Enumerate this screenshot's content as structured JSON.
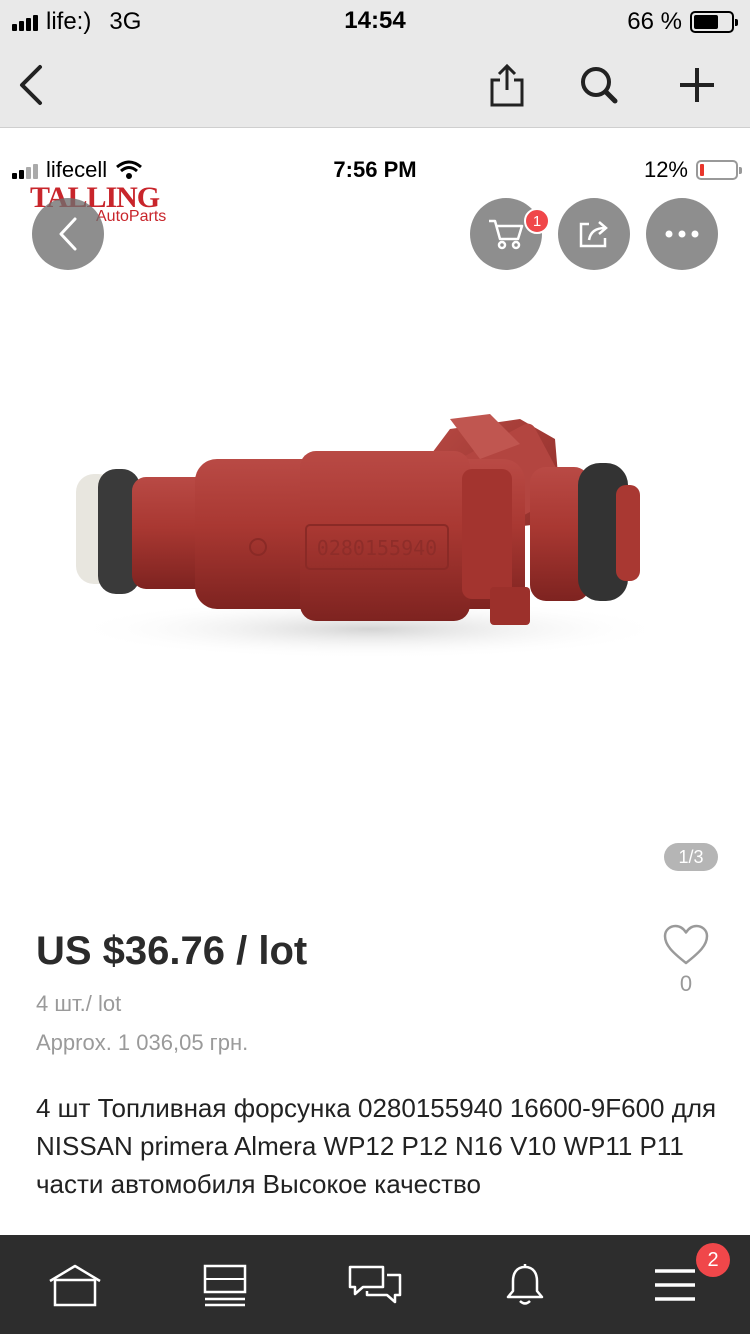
{
  "outer_status": {
    "carrier": "life:)",
    "network": "3G",
    "time": "14:54",
    "battery": "66 %"
  },
  "outer_nav": {
    "back_icon": "chevron-left-icon",
    "share_icon": "share-icon",
    "search_icon": "search-icon",
    "add_icon": "plus-icon"
  },
  "inner_status": {
    "carrier": "lifecell",
    "time": "7:56 PM",
    "battery": "12%"
  },
  "logo": {
    "brand": "TALLING",
    "sub": "AutoParts"
  },
  "overlay_buttons": {
    "cart_badge": "1"
  },
  "gallery": {
    "counter": "1/3",
    "part_number_print": "0280155940"
  },
  "product": {
    "price": "US $36.76 / lot",
    "quantity": "4 шт./ lot",
    "approx": "Approx. 1 036,05 грн.",
    "wishlist_count": "0",
    "title": "4 шт Топливная форсунка 0280155940 16600-9F600 для NISSAN primera Almera WP12 P12 N16 V10 WP11 P11 части автомобиля Высокое качество"
  },
  "tabbar": {
    "items": [
      "home-icon",
      "list-icon",
      "messages-icon",
      "bell-icon",
      "menu-icon"
    ],
    "menu_badge": "2"
  },
  "colors": {
    "badge": "#f0474a",
    "brand_red": "#c8252b",
    "tabbar_bg": "#2d2d2d"
  }
}
